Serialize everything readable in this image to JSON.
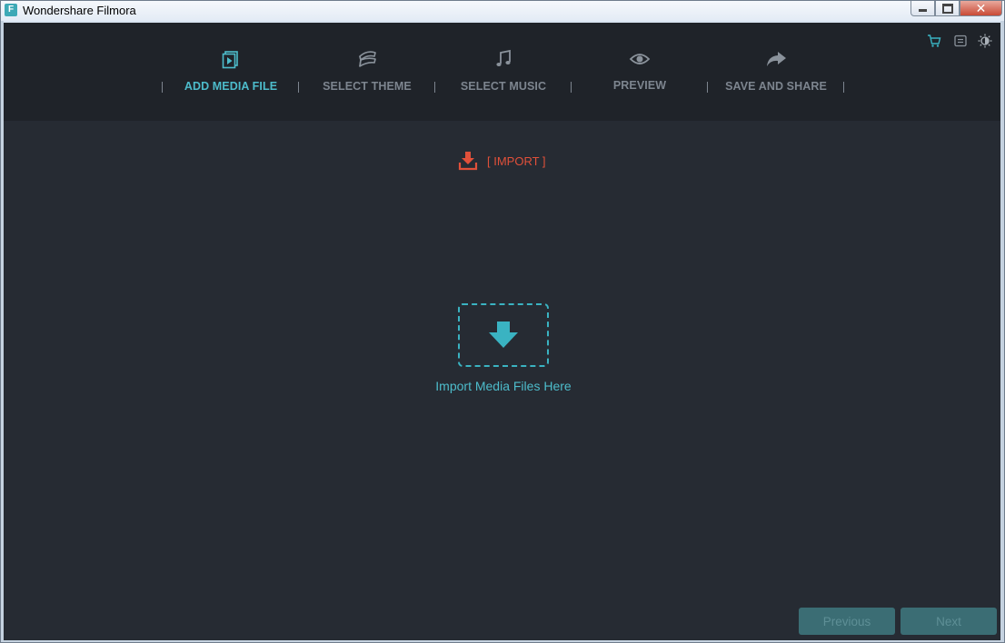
{
  "window": {
    "title": "Wondershare Filmora",
    "app_icon_letter": "F",
    "close_glyph": "✕"
  },
  "steps": [
    {
      "label": "ADD MEDIA FILE",
      "icon": "media-file-icon",
      "active": true
    },
    {
      "label": "SELECT THEME",
      "icon": "theme-icon",
      "active": false
    },
    {
      "label": "SELECT MUSIC",
      "icon": "music-note-icon",
      "active": false
    },
    {
      "label": "PREVIEW",
      "icon": "eye-icon",
      "active": false
    },
    {
      "label": "SAVE AND SHARE",
      "icon": "share-arrow-icon",
      "active": false
    }
  ],
  "top_icons": [
    "cart-icon",
    "menu-icon",
    "theme-toggle-icon"
  ],
  "import": {
    "label": "[ IMPORT ]"
  },
  "dropzone": {
    "text": "Import Media Files Here"
  },
  "footer": {
    "previous_label": "Previous",
    "next_label": "Next"
  },
  "colors": {
    "accent": "#4dbccb",
    "import_red": "#e0503a",
    "header_bg": "#1f2329",
    "body_bg": "#262b33",
    "button_bg": "#3b6d74"
  }
}
